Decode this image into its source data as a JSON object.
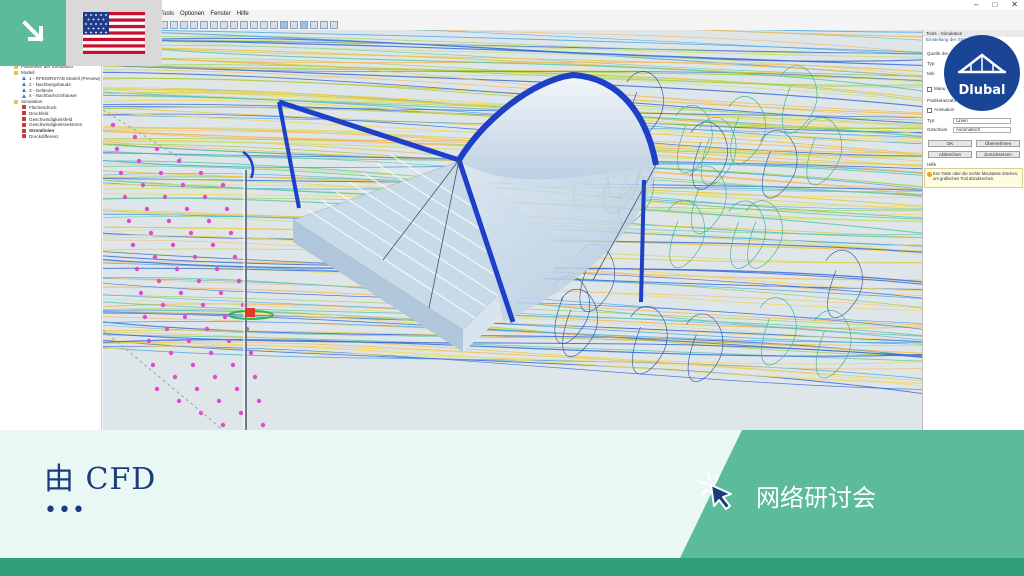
{
  "app": {
    "menu": [
      "Tools",
      "Optionen",
      "Fenster",
      "Hilfe"
    ],
    "window_buttons": [
      "–",
      "□",
      "✕"
    ],
    "navigator": [
      {
        "label": "Parameter der Simulation",
        "icon": "folder",
        "indent": 0,
        "bold": false
      },
      {
        "label": "Modell",
        "icon": "folder",
        "indent": 0,
        "bold": false
      },
      {
        "label": "1 - RFEM/RSTAB Modell (Preview)",
        "icon": "tri",
        "indent": 1,
        "bold": false
      },
      {
        "label": "2 - Nachbargebäude",
        "icon": "tri",
        "indent": 1,
        "bold": false
      },
      {
        "label": "3 - Gelände",
        "icon": "tri",
        "indent": 1,
        "bold": false
      },
      {
        "label": "4 - Nachbarhochhäuser",
        "icon": "tri",
        "indent": 1,
        "bold": false
      },
      {
        "label": "Simulation",
        "icon": "folder",
        "indent": 0,
        "bold": false
      },
      {
        "label": "Flächendruck",
        "icon": "result",
        "indent": 1,
        "bold": false
      },
      {
        "label": "Druckfeld",
        "icon": "result",
        "indent": 1,
        "bold": false
      },
      {
        "label": "Geschwindigkeitsfeld",
        "icon": "result",
        "indent": 1,
        "bold": false
      },
      {
        "label": "Geschwindigkeitsvektoren",
        "icon": "result",
        "indent": 1,
        "bold": false
      },
      {
        "label": "Stromlinien",
        "icon": "result",
        "indent": 1,
        "bold": true
      },
      {
        "label": "Druckdifferenz",
        "icon": "result",
        "indent": 1,
        "bold": false
      }
    ],
    "panel": {
      "title": "Tools - Simulation",
      "section": "Einstellung der Stromlinien",
      "source_label": "Quelle der",
      "type_label": "Typ",
      "min_label": "Min",
      "manual_label": "Manu",
      "particles_label": "Partikelanzahl",
      "animation_label": "Animation",
      "typ2_label": "Typ",
      "typ2_value": "Linien",
      "speed_label": "Geschwin",
      "speed_value": "Automatisch",
      "ok_button": "OK",
      "apply_button": "Übernehmen",
      "cancel_button": "Abbrechen",
      "reset_button": "Zurücksetzen",
      "help_title": "Hilfe",
      "help_text": "Esc-Taste oder die rechte Maustaste drücken, um grafisches Tool abzubrechen."
    }
  },
  "logo": {
    "text": "Dlubal"
  },
  "banner": {
    "headline": "由 CFD",
    "ellipsis": "•••",
    "webinar_label": "网络研讨会"
  },
  "colors": {
    "accent_green": "#5cbb9a",
    "dark_green": "#2f9e7a",
    "banner_bg": "#e9f8f4",
    "headline_blue": "#1c3d7a",
    "dlubal_blue": "#1a4597"
  }
}
